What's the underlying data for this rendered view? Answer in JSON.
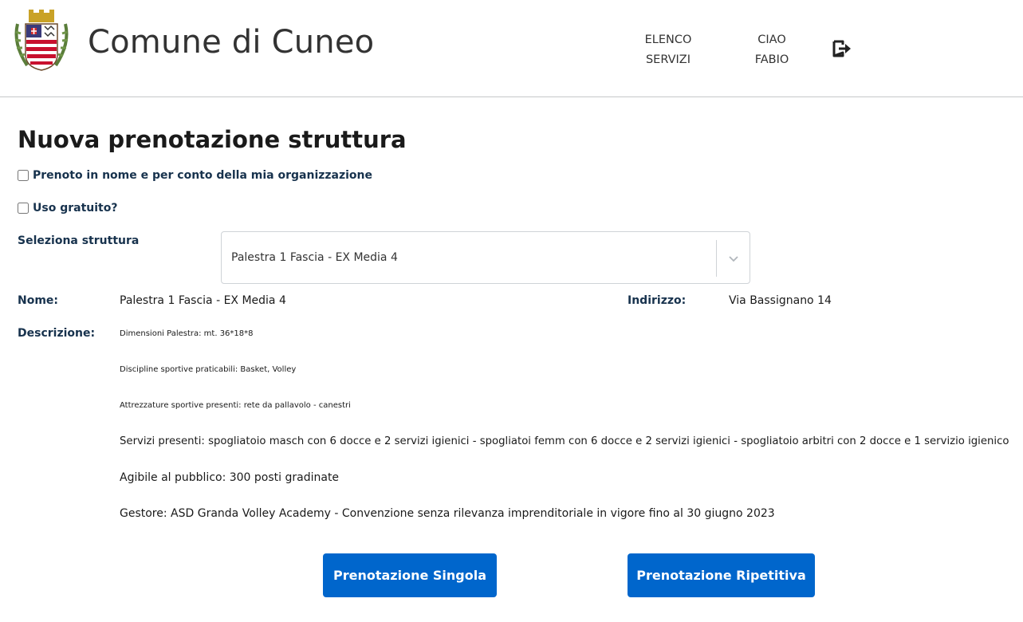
{
  "header": {
    "site_title": "Comune di Cuneo",
    "nav": {
      "services_line1": "ELENCO",
      "services_line2": "SERVIZI",
      "user_line1": "CIAO",
      "user_line2": "FABIO"
    },
    "logo_icon": "coat-of-arms-icon",
    "logout_icon": "logout-icon"
  },
  "page": {
    "title": "Nuova prenotazione struttura",
    "checkbox_org_label": "Prenoto in nome e per conto della mia organizzazione",
    "checkbox_free_label": "Uso gratuito?",
    "select_label": "Seleziona struttura",
    "select_value": "Palestra 1 Fascia - EX Media 4"
  },
  "details": {
    "nome_label": "Nome:",
    "nome_value": "Palestra 1 Fascia - EX Media 4",
    "indirizzo_label": "Indirizzo:",
    "indirizzo_value": "Via Bassignano 14",
    "descrizione_label": "Descrizione:",
    "descrizione_lines": [
      "Dimensioni Palestra: mt. 36*18*8",
      "Discipline sportive praticabili: Basket, Volley",
      "Attrezzature sportive presenti:  rete da pallavolo - canestri",
      "Servizi presenti: spogliatoio masch con 6 docce e 2 servizi igienici - spogliatoi femm con 6 docce e 2 servizi igienici - spogliatoio arbitri con 2 docce e 1 servizio igienico",
      "Agibile al pubblico: 300 posti gradinate",
      "Gestore: ASD Granda Volley Academy - Convenzione senza rilevanza imprenditoriale in vigore fino al 30 giugno 2023"
    ]
  },
  "buttons": {
    "single": "Prenotazione Singola",
    "repeat": "Prenotazione Ripetitiva"
  },
  "colors": {
    "primary": "#0066cc",
    "label": "#17324d"
  }
}
